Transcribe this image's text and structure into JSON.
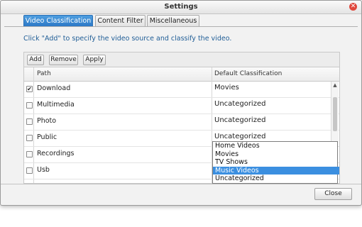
{
  "window": {
    "title": "Settings",
    "close_icon": "close-icon"
  },
  "tabs": [
    {
      "label": "Video Classification",
      "active": true
    },
    {
      "label": "Content Filter",
      "active": false
    },
    {
      "label": "Miscellaneous",
      "active": false
    }
  ],
  "instructions": "Click \"Add\" to specify the video source and classify the video.",
  "toolbar": {
    "add_label": "Add",
    "remove_label": "Remove",
    "apply_label": "Apply"
  },
  "table": {
    "columns": [
      "Path",
      "Default Classification"
    ],
    "rows": [
      {
        "checked": true,
        "path": "Download",
        "classification": "Movies"
      },
      {
        "checked": false,
        "path": "Multimedia",
        "classification": "Uncategorized"
      },
      {
        "checked": false,
        "path": "Photo",
        "classification": "Uncategorized"
      },
      {
        "checked": false,
        "path": "Public",
        "classification": "Uncategorized"
      },
      {
        "checked": false,
        "path": "Recordings",
        "classification": ""
      },
      {
        "checked": false,
        "path": "Usb",
        "classification": ""
      }
    ]
  },
  "dropdown": {
    "options": [
      "Home Videos",
      "Movies",
      "TV Shows",
      "Music Videos",
      "Uncategorized"
    ],
    "highlighted": "Music Videos"
  },
  "footer": {
    "close_label": "Close"
  },
  "colors": {
    "accent": "#2c78c6",
    "highlight": "#3b8fe0",
    "instruction_text": "#1f5d96",
    "close_icon": "#e0483d"
  }
}
